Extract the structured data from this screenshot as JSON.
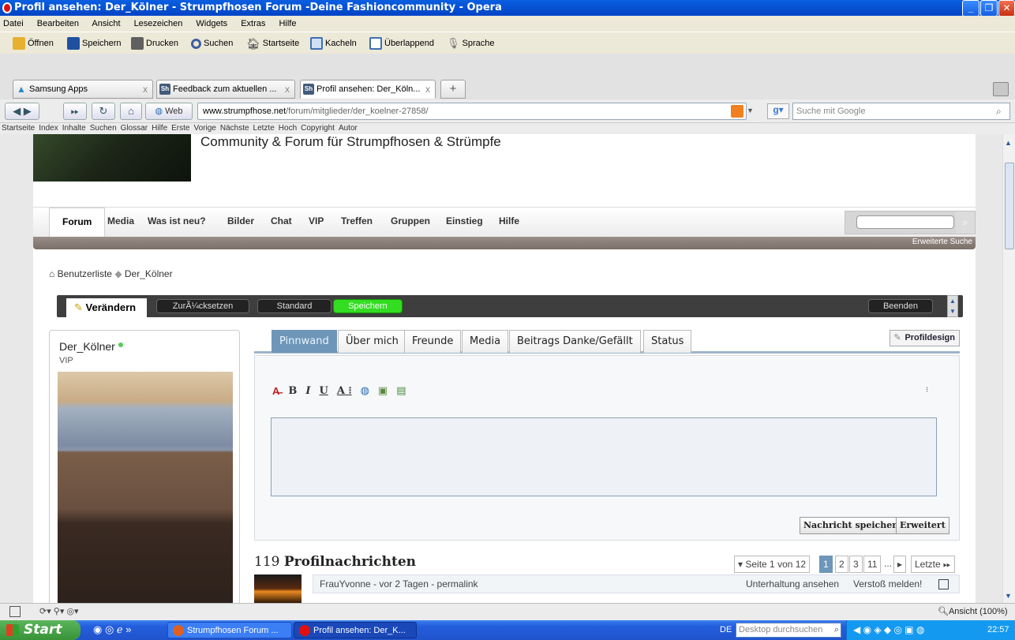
{
  "window": {
    "title": "Profil ansehen: Der_Kölner - Strumpfhosen Forum -Deine Fashioncommunity - Opera"
  },
  "menu": [
    "Datei",
    "Bearbeiten",
    "Ansicht",
    "Lesezeichen",
    "Widgets",
    "Extras",
    "Hilfe"
  ],
  "toolbar": {
    "open": "Öffnen",
    "save": "Speichern",
    "print": "Drucken",
    "search": "Suchen",
    "home": "Startseite",
    "tile": "Kacheln",
    "cascade": "Überlappend",
    "voice": "Sprache"
  },
  "tabs": [
    {
      "label": "Samsung Apps",
      "icon": "samsung-icon"
    },
    {
      "label": "Feedback zum aktuellen ...",
      "icon": "site-icon"
    },
    {
      "label": "Profil ansehen: Der_Köln...",
      "icon": "site-icon"
    }
  ],
  "nav": {
    "web_label": "Web",
    "address_domain": "www.strumpfhose.net",
    "address_path": "/forum/mitglieder/der_koelner-27858/",
    "search_placeholder": "Suche mit Google"
  },
  "linkbar": [
    "Startseite",
    "Index",
    "Inhalte",
    "Suchen",
    "Glossar",
    "Hilfe",
    "Erste",
    "Vorige",
    "Nächste",
    "Letzte",
    "Hoch",
    "Copyright",
    "Autor"
  ],
  "site": {
    "header_title": "Community & Forum für Strumpfhosen & Strümpfe",
    "nav_items": [
      "Forum",
      "Media",
      "Was ist neu?",
      "Bilder",
      "Chat",
      "VIP",
      "Treffen",
      "Gruppen",
      "Einstieg",
      "Hilfe"
    ],
    "advanced_search": "Erweiterte Suche",
    "breadcrumb_home": "Benutzerliste",
    "breadcrumb_current": "Der_Kölner"
  },
  "editbar": {
    "tab": "Verändern",
    "reset": "ZurÃ¼cksetzen",
    "standard": "Standard",
    "save": "Speichern",
    "end": "Beenden"
  },
  "profile": {
    "name": "Der_Kölner",
    "rank": "VIP",
    "tabs": [
      "Pinnwand",
      "Über mich",
      "Freunde",
      "Media",
      "Beitrags Danke/Gefällt",
      "Status"
    ],
    "design_button": "Profildesign",
    "save_message": "Nachricht speichern",
    "advanced": "Erweitert",
    "message_count": "119",
    "message_heading": "Profilnachrichten",
    "pager": {
      "label": "Seite 1 von 12",
      "pages": [
        "1",
        "2",
        "3",
        "11"
      ],
      "ellipsis": "...",
      "last": "Letzte"
    },
    "message": {
      "meta": "FrauYvonne - vor 2 Tagen - permalink",
      "conversation": "Unterhaltung ansehen",
      "report": "Verstoß melden!"
    }
  },
  "status": {
    "zoom": "Ansicht (100%)"
  },
  "taskbar": {
    "start": "Start",
    "tasks": [
      "Strumpfhosen Forum ...",
      "Profil ansehen: Der_K..."
    ],
    "lang": "DE",
    "desktop_search": "Desktop durchsuchen",
    "clock": "22:57"
  }
}
